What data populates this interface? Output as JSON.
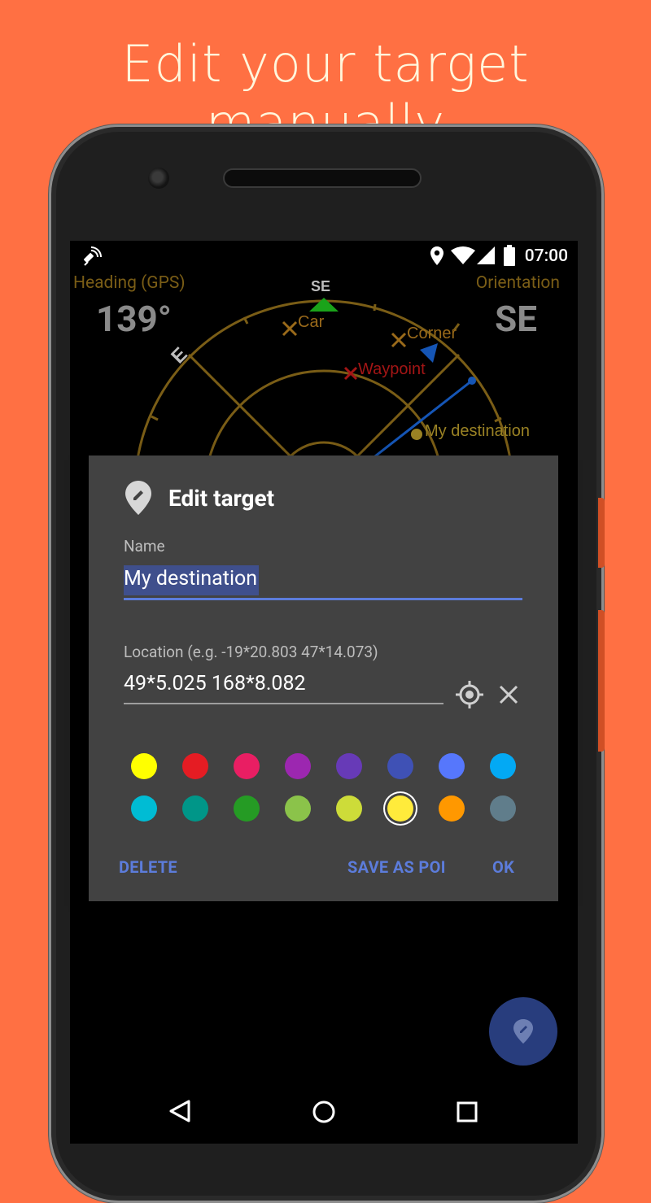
{
  "promo": {
    "headline": "Edit your target manually"
  },
  "status_bar": {
    "time": "07:00"
  },
  "compass": {
    "heading_label": "Heading (GPS)",
    "heading_value": "139°",
    "orientation_label": "Orientation",
    "orientation_value": "SE",
    "direction_top": "SE",
    "direction_left": "E",
    "targets": [
      {
        "name": "Car"
      },
      {
        "name": "Corner"
      },
      {
        "name": "Waypoint"
      },
      {
        "name": "My destination"
      }
    ],
    "colors": {
      "ring": "#7a5d16",
      "targets": "#9a6a1a",
      "waypoint": "#a31515",
      "needle": "#1555b5",
      "north_marker": "#1aa31a"
    }
  },
  "dialog": {
    "title": "Edit target",
    "name_label": "Name",
    "name_value": "My destination",
    "location_label": "Location (e.g. -19*20.803 47*14.073)",
    "location_value": "49*5.025 168*8.082",
    "colors": [
      "#ffff00",
      "#e51c23",
      "#e91e63",
      "#9c27b0",
      "#673ab7",
      "#3f51b5",
      "#5677fc",
      "#03a9f4",
      "#00bcd4",
      "#009688",
      "#259b24",
      "#8bc34a",
      "#cddc39",
      "#ffeb3b",
      "#ff9800",
      "#607d8b"
    ],
    "selected_color_index": 13,
    "buttons": {
      "delete": "DELETE",
      "save_poi": "SAVE AS POI",
      "ok": "OK"
    },
    "accent": "#5c7cdb"
  }
}
